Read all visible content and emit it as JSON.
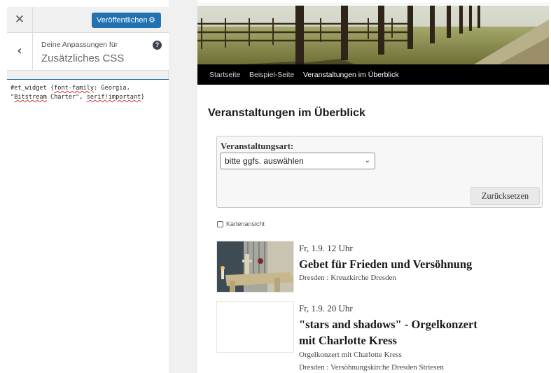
{
  "customizer": {
    "publish_label": "Veröffentlichen",
    "section_kicker": "Deine Anpassungen für",
    "section_title": "Zusätzliches CSS",
    "css_code": {
      "s1": "#et_widget {",
      "s2": "font-family",
      "s3": ": Georgia,",
      "s4": "\"",
      "s5": "Bitstream",
      "s6": " Charter\", ",
      "s7": "serif!important",
      "s8": "}"
    }
  },
  "preview": {
    "nav": [
      "Startseite",
      "Beispiel-Seite",
      "Veranstaltungen im Überblick"
    ],
    "page_title": "Veranstaltungen im Überblick",
    "filter": {
      "label": "Veranstaltungsart:",
      "select_value": "bitte ggfs. auswählen",
      "reset_label": "Zurücksetzen"
    },
    "map_view_label": "Kartenansicht",
    "events": [
      {
        "date": "Fr, 1.9. 12 Uhr",
        "title": "Gebet für Frieden und Versöhnung",
        "location": "Dresden : Kreuzkirche Dresden"
      },
      {
        "date": "Fr, 1.9. 20 Uhr",
        "title_line1": "\"stars and shadows\" - Orgelkonzert",
        "title_line2": "mit Charlotte Kress",
        "subtitle": "Orgelkonzert mit Charlotte Kress",
        "location": "Dresden : Versöhnungskirche Dresden Striesen"
      }
    ]
  },
  "colors": {
    "publish_button": "#2271b1",
    "nav_bar": "#000000",
    "sidebar_bg": "#f0f0f1"
  }
}
